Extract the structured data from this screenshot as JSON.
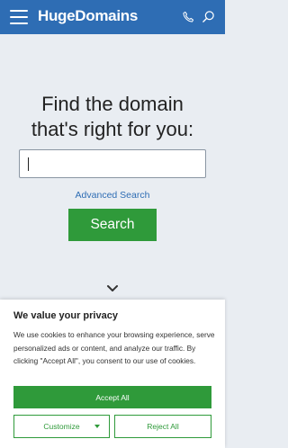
{
  "header": {
    "logo_text": "HugeDomains",
    "icons": [
      "hamburger-menu-icon",
      "phone-icon",
      "search-icon"
    ],
    "background_color": "#2e6db4"
  },
  "hero": {
    "title_line1": "Find the domain",
    "title_line2": "that's right for you:",
    "search_input_value": "",
    "advanced_search_label": "Advanced Search",
    "search_button_label": "Search",
    "accent_color": "#2f9a3a"
  },
  "cookie_banner": {
    "title": "We value your privacy",
    "text": "We use cookies to enhance your browsing experience, serve personalized ads or content, and analyze our traffic. By clicking \"Accept All\", you consent to our use of cookies.",
    "accept_all_label": "Accept All",
    "customize_label": "Customize",
    "reject_all_label": "Reject All"
  }
}
